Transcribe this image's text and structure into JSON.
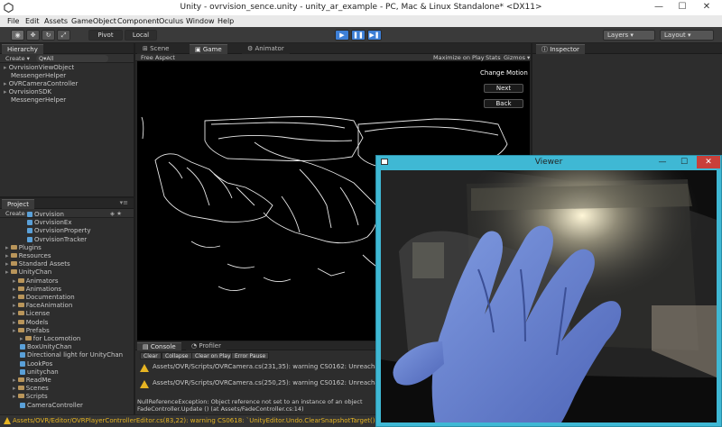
{
  "window": {
    "title": "Unity - ovrvision_sence.unity - unity_ar_example - PC, Mac & Linux Standalone* <DX11>",
    "minimize": "—",
    "maximize": "☐",
    "close": "✕"
  },
  "menu": [
    "File",
    "Edit",
    "Assets",
    "GameObject",
    "Component",
    "Oculus",
    "Window",
    "Help"
  ],
  "toolbar": {
    "pivot": "Pivot",
    "local": "Local",
    "layers": "Layers",
    "layout": "Layout"
  },
  "hierarchy": {
    "tab": "Hierarchy",
    "create": "Create ▾",
    "search": "Q▾All",
    "items": [
      "OvrvisionViewObject",
      "MessengerHelper",
      "OVRCameraController",
      "OvrvisionSDK",
      "MessengerHelper"
    ]
  },
  "scene_tabs": {
    "scene": "Scene",
    "game": "Game",
    "animator": "Animator",
    "aspect": "Free Aspect",
    "maximize_on_play": "Maximize on Play",
    "stats": "Stats",
    "gizmos": "Gizmos ▾"
  },
  "inspector": {
    "tab": "Inspector"
  },
  "game": {
    "change_motion": "Change Motion",
    "next": "Next",
    "back": "Back"
  },
  "project": {
    "tab": "Project",
    "create": "Create ▾",
    "items": [
      {
        "label": "Ovrvision",
        "kind": "script",
        "indent": 3
      },
      {
        "label": "OvrvisionEx",
        "kind": "script",
        "indent": 3
      },
      {
        "label": "OvrvisionProperty",
        "kind": "script",
        "indent": 3
      },
      {
        "label": "OvrvisionTracker",
        "kind": "script",
        "indent": 3
      },
      {
        "label": "Plugins",
        "kind": "folder",
        "indent": 0
      },
      {
        "label": "Resources",
        "kind": "folder",
        "indent": 0
      },
      {
        "label": "Standard Assets",
        "kind": "folder",
        "indent": 0
      },
      {
        "label": "UnityChan",
        "kind": "folder",
        "indent": 0
      },
      {
        "label": "Animators",
        "kind": "folder",
        "indent": 1
      },
      {
        "label": "Animations",
        "kind": "folder",
        "indent": 1
      },
      {
        "label": "Documentation",
        "kind": "folder",
        "indent": 1
      },
      {
        "label": "FaceAnimation",
        "kind": "folder",
        "indent": 1
      },
      {
        "label": "License",
        "kind": "folder",
        "indent": 1
      },
      {
        "label": "Models",
        "kind": "folder",
        "indent": 1
      },
      {
        "label": "Prefabs",
        "kind": "folder",
        "indent": 1
      },
      {
        "label": "for Locomotion",
        "kind": "folder",
        "indent": 2
      },
      {
        "label": "BoxUnityChan",
        "kind": "script",
        "indent": 2
      },
      {
        "label": "Directional light for UnityChan",
        "kind": "script",
        "indent": 2
      },
      {
        "label": "LookPos",
        "kind": "script",
        "indent": 2
      },
      {
        "label": "unitychan",
        "kind": "script",
        "indent": 2
      },
      {
        "label": "ReadMe",
        "kind": "folder",
        "indent": 1
      },
      {
        "label": "Scenes",
        "kind": "folder",
        "indent": 1
      },
      {
        "label": "Scripts",
        "kind": "folder",
        "indent": 1
      },
      {
        "label": "CameraController",
        "kind": "script",
        "indent": 2
      }
    ]
  },
  "console": {
    "tab": "Console",
    "tab2": "Profiler",
    "clear": "Clear",
    "collapse": "Collapse",
    "clear_on_play": "Clear on Play",
    "error_pause": "Error Pause",
    "warning1": "Assets/OVR/Scripts/OVRCamera.cs(231,35): warning CS0162: Unreachab",
    "warning2": "Assets/OVR/Scripts/OVRCamera.cs(250,25): warning CS0162: Unreachab",
    "error_line1": "NullReferenceException: Object reference not set to an instance of an object",
    "error_line2": "FadeController.Update () (at Assets/FadeController.cs:14)"
  },
  "status": {
    "message": "Assets/OVR/Editor/OVRPlayerControllerEditor.cs(83,22): warning CS0618: `UnityEditor.Undo.ClearSnapshotTarget()' is"
  },
  "viewer": {
    "title": "Viewer",
    "minimize": "—",
    "maximize": "☐",
    "close": "✕"
  }
}
